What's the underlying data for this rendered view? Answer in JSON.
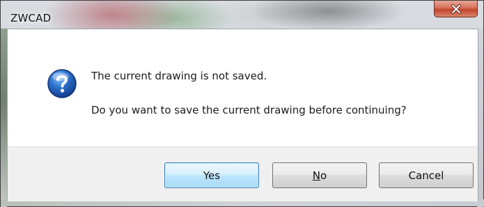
{
  "window": {
    "title": "ZWCAD"
  },
  "message": {
    "line1": "The current drawing is not saved.",
    "line2": "Do you want to save the current drawing before continuing?",
    "icon": "question-icon"
  },
  "buttons": {
    "yes": {
      "label": "Yes",
      "default": true
    },
    "no": {
      "prefix": "",
      "mnemonic": "N",
      "rest": "o"
    },
    "cancel": {
      "label": "Cancel"
    }
  },
  "colors": {
    "close_button": "#c2452b",
    "default_button_border": "#3c7fb1",
    "icon_blue": "#1f5fb8"
  }
}
